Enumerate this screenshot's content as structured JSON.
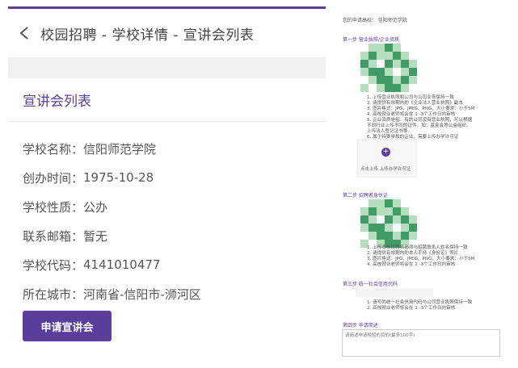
{
  "colors": {
    "accent": "#5b3d9c",
    "qr_dark": "#1e8a4c",
    "qr_light": "#a8d8b4"
  },
  "left": {
    "nav": {
      "back_icon": "chevron-left-icon",
      "title": "校园招聘 - 学校详情 - 宣讲会列表"
    },
    "section_title": "宣讲会列表",
    "info": [
      {
        "label": "学校名称：",
        "value": "信阳师范学院"
      },
      {
        "label": "创办时间：",
        "value": "1975-10-28"
      },
      {
        "label": "学校性质：",
        "value": "公办"
      },
      {
        "label": "联系邮箱：",
        "value": "暂无"
      },
      {
        "label": "学校代码：",
        "value": "4141010477"
      },
      {
        "label": "所在城市：",
        "value": "河南省-信阳市-浉河区"
      }
    ],
    "apply_button": "申请宣讲会"
  },
  "right": {
    "current_school": "您的申请高校：  信阳师范学院",
    "step1": {
      "title": "第一步  营业执照/企业资质",
      "notes": [
        "1. 上传营业执照和公司与公司业务保持一致",
        "2. 请提供有效期内的《企业法人营业执照》副本",
        "3. 图片格式：JPG、JPEG、PNG，大小要求：小于5M",
        "4. 高校就业老师将会在 1 -3个工作日内审核",
        "5. 企业资质是指：有的公司没有营业执照，可以根据",
        "   不同行业上传不同的证件，如：基金会等公益组织、",
        "   上传法人登记证书等。",
        "6. 属于特殊学校的企业，需要上传办学许可证"
      ],
      "upload_label": "点击上传  上传办学许可证"
    },
    "step2": {
      "title": "第二步  招聘者身份证",
      "notes": [
        "1. 上传身份证姓名必须与招聘联系人姓名保持一致",
        "2. 请提供有效期内的本人手持《身份证》照片",
        "3. 图片格式：JPG、JPEG、PNG，大小要求：小于5M",
        "4. 高校就业老师将会在 1 -3个工作日内审核"
      ]
    },
    "step3": {
      "title": "第三步  统一社会信用代码",
      "notes": [
        "1. 请写的统一社会信用代码与公司营业执照保持一致",
        "2. 高校就业老师将会在 1 -3个工作日内审核"
      ]
    },
    "step4": {
      "title": "第四步  申请简述",
      "placeholder": "请简述申请校招的目的(最多100字)"
    }
  }
}
